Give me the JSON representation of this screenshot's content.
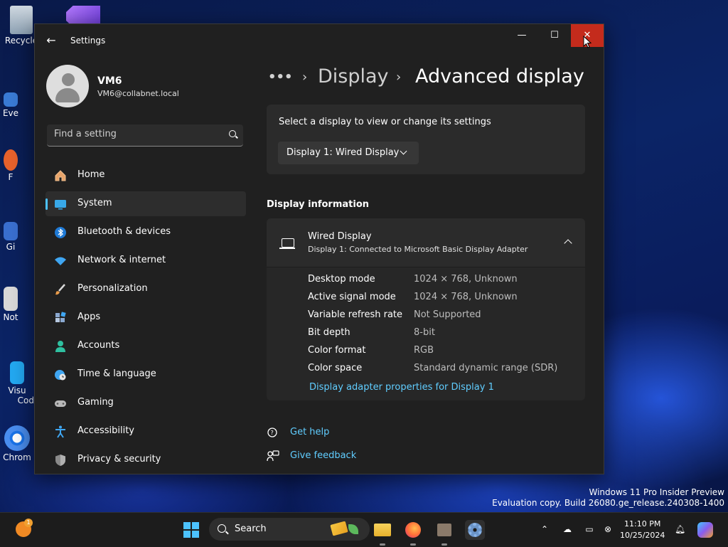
{
  "desktop": {
    "icons": [
      {
        "label": "Recycle"
      },
      {
        "label": "Eve"
      },
      {
        "label": "F"
      },
      {
        "label": "Gi"
      },
      {
        "label": "Not"
      },
      {
        "label": "Visu"
      },
      {
        "label": "Cod"
      },
      {
        "label": "Chrom"
      }
    ],
    "watermark_line1": "Windows 11 Pro Insider Preview",
    "watermark_line2": "Evaluation copy. Build 26080.ge_release.240308-1400"
  },
  "window": {
    "title": "Settings",
    "back_icon": "arrow-left-icon",
    "minimize_glyph": "—",
    "maximize_glyph": "☐",
    "close_glyph": "✕",
    "close_color": "#c42b1c"
  },
  "user": {
    "name": "VM6",
    "email": "VM6@collabnet.local"
  },
  "search": {
    "placeholder": "Find a setting"
  },
  "nav": {
    "accent": "#4cc2ff",
    "items": [
      {
        "label": "Home",
        "icon": "home-icon",
        "active": false
      },
      {
        "label": "System",
        "icon": "system-icon",
        "active": true
      },
      {
        "label": "Bluetooth & devices",
        "icon": "bluetooth-icon",
        "active": false
      },
      {
        "label": "Network & internet",
        "icon": "wifi-icon",
        "active": false
      },
      {
        "label": "Personalization",
        "icon": "brush-icon",
        "active": false
      },
      {
        "label": "Apps",
        "icon": "apps-icon",
        "active": false
      },
      {
        "label": "Accounts",
        "icon": "accounts-icon",
        "active": false
      },
      {
        "label": "Time & language",
        "icon": "globe-clock-icon",
        "active": false
      },
      {
        "label": "Gaming",
        "icon": "gamepad-icon",
        "active": false
      },
      {
        "label": "Accessibility",
        "icon": "accessibility-icon",
        "active": false
      },
      {
        "label": "Privacy & security",
        "icon": "shield-icon",
        "active": false
      }
    ]
  },
  "breadcrumb": {
    "more": "•••",
    "sep": "›",
    "parent": "Display",
    "current": "Advanced display"
  },
  "display_select": {
    "prompt": "Select a display to view or change its settings",
    "selected": "Display 1: Wired Display"
  },
  "display_info": {
    "section_title": "Display information",
    "name": "Wired Display",
    "subtitle": "Display 1: Connected to Microsoft Basic Display Adapter",
    "rows": [
      {
        "label": "Desktop mode",
        "value": "1024 × 768, Unknown"
      },
      {
        "label": "Active signal mode",
        "value": "1024 × 768, Unknown"
      },
      {
        "label": "Variable refresh rate",
        "value": "Not Supported"
      },
      {
        "label": "Bit depth",
        "value": "8-bit"
      },
      {
        "label": "Color format",
        "value": "RGB"
      },
      {
        "label": "Color space",
        "value": "Standard dynamic range (SDR)"
      }
    ],
    "adapter_link": "Display adapter properties for Display 1",
    "link_color": "#60cdff"
  },
  "help": {
    "get_help": "Get help",
    "give_feedback": "Give feedback"
  },
  "taskbar": {
    "search_label": "Search",
    "weather_badge": "1",
    "time": "11:10 PM",
    "date": "10/25/2024"
  }
}
